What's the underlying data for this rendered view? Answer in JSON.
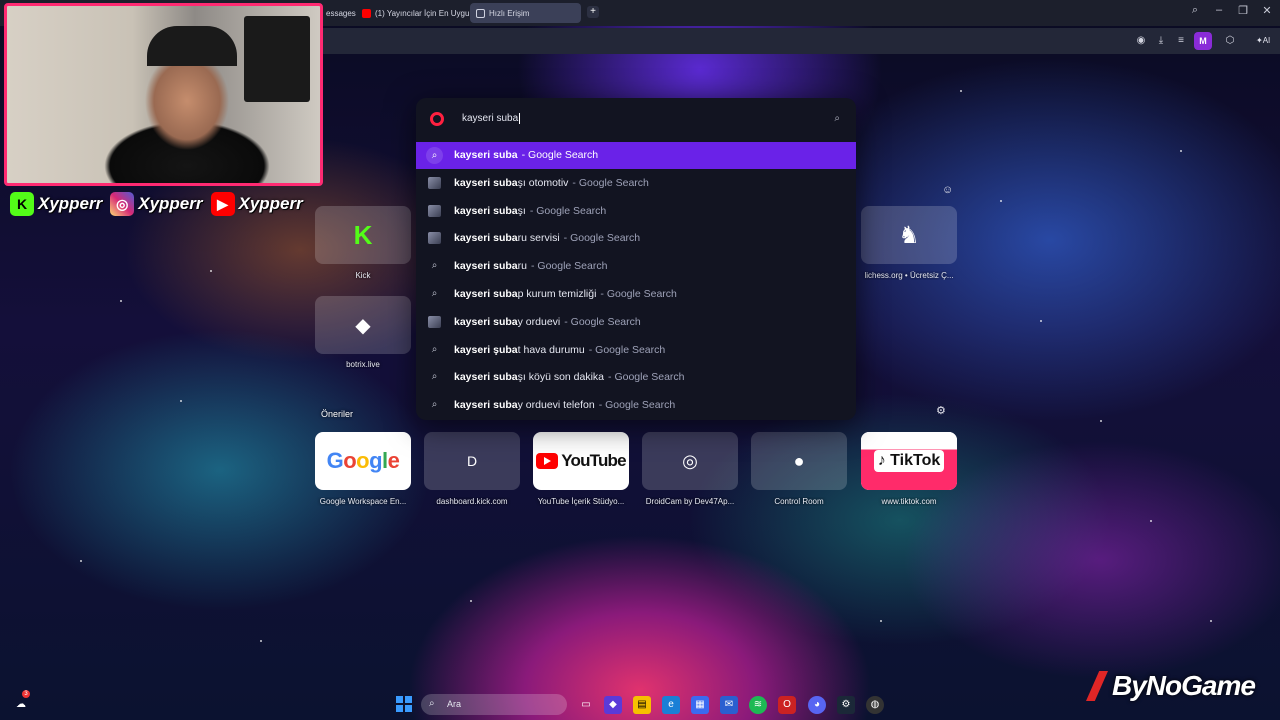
{
  "browser": {
    "tabs": [
      {
        "label": "essages",
        "active": false
      },
      {
        "label": "(1) Yayıncılar İçin En Uygu",
        "active": false
      },
      {
        "label": "Hızlı Erişim",
        "active": true
      }
    ],
    "new_tab_label": "+",
    "toolbar": {
      "profile_initial": "M",
      "ai_label": "AI"
    }
  },
  "streamer": {
    "handles": [
      {
        "platform": "kick-icon",
        "name": "Xypperr",
        "color": "#53fc18"
      },
      {
        "platform": "instagram-icon",
        "name": "Xypperr",
        "color": "#d6249f"
      },
      {
        "platform": "youtube-icon",
        "name": "Xypperr",
        "color": "#ff0000"
      }
    ]
  },
  "omnibox": {
    "query": "kayseri suba",
    "suggestions": [
      {
        "bold": "kayseri suba",
        "rest": "",
        "suffix": "- Google Search",
        "icon": "search-circle",
        "selected": true
      },
      {
        "bold": "kayseri suba",
        "rest": "şı otomotiv",
        "suffix": "- Google Search",
        "icon": "thumbnail"
      },
      {
        "bold": "kayseri suba",
        "rest": "şı",
        "suffix": "- Google Search",
        "icon": "thumbnail"
      },
      {
        "bold": "kayseri suba",
        "rest": "ru servisi",
        "suffix": "- Google Search",
        "icon": "thumbnail"
      },
      {
        "bold": "kayseri suba",
        "rest": "ru",
        "suffix": "- Google Search",
        "icon": "search"
      },
      {
        "bold": "kayseri suba",
        "rest": "p kurum temizliği",
        "suffix": "- Google Search",
        "icon": "search"
      },
      {
        "bold": "kayseri suba",
        "rest": "y orduevi",
        "suffix": "- Google Search",
        "icon": "thumbnail"
      },
      {
        "bold": "kayseri şuba",
        "rest": "t hava durumu",
        "suffix": "- Google Search",
        "icon": "search"
      },
      {
        "bold": "kayseri suba",
        "rest": "şı köyü son dakika",
        "suffix": "- Google Search",
        "icon": "search"
      },
      {
        "bold": "kayseri suba",
        "rest": "y orduevi telefon",
        "suffix": "- Google Search",
        "icon": "search"
      }
    ]
  },
  "speed_dials": {
    "top": [
      {
        "label": "Kick"
      },
      {
        "label": "botrix.live"
      },
      {
        "label": "lichess.org • Ücretsiz Ç..."
      }
    ],
    "section_title": "Öneriler",
    "suggested": [
      {
        "label": "Google Workspace En...",
        "logo": "Google"
      },
      {
        "label": "dashboard.kick.com",
        "logo": "D"
      },
      {
        "label": "YouTube İçerik Stüdyo...",
        "logo": "YouTube"
      },
      {
        "label": "DroidCam by Dev47Ap...",
        "logo": ""
      },
      {
        "label": "Control Room",
        "logo": ""
      },
      {
        "label": "www.tiktok.com",
        "logo": "TikTok"
      }
    ]
  },
  "taskbar": {
    "search_placeholder": "Ara",
    "notification_badge": "3"
  },
  "watermark": "ByNoGame",
  "colors": {
    "accent": "#6a22e8",
    "cam_border": "#ff2a72"
  }
}
